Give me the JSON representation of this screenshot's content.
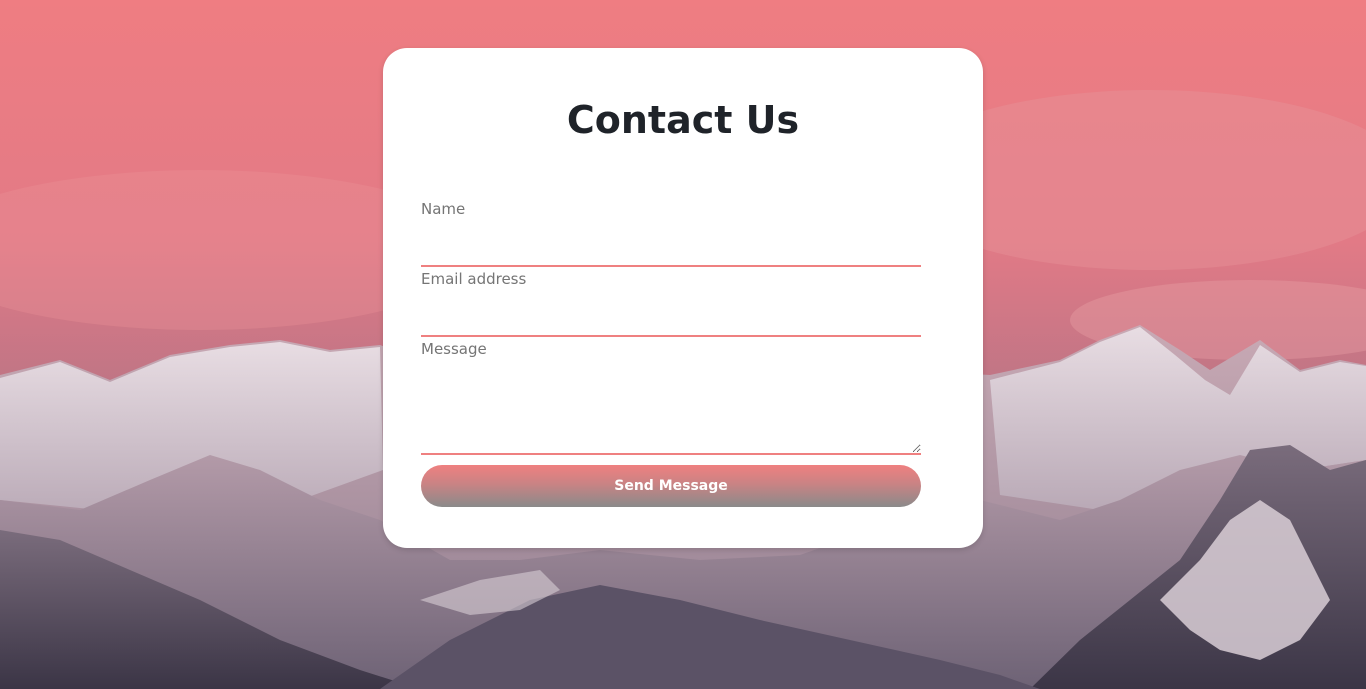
{
  "contact": {
    "title": "Contact Us",
    "fields": {
      "name": {
        "label": "Name",
        "value": "",
        "placeholder": ""
      },
      "email": {
        "label": "Email address",
        "value": "",
        "placeholder": ""
      },
      "message": {
        "label": "Message",
        "value": "",
        "placeholder": ""
      }
    },
    "submit_label": "Send Message"
  },
  "colors": {
    "accent": "#ef8080",
    "title_text": "#1f2329",
    "label_text": "#757575",
    "card_background": "#ffffff",
    "sky_top": "#ef7d82",
    "mountain_shadow": "#3b3546"
  },
  "background": {
    "description_icon": "mountain-landscape-image"
  }
}
